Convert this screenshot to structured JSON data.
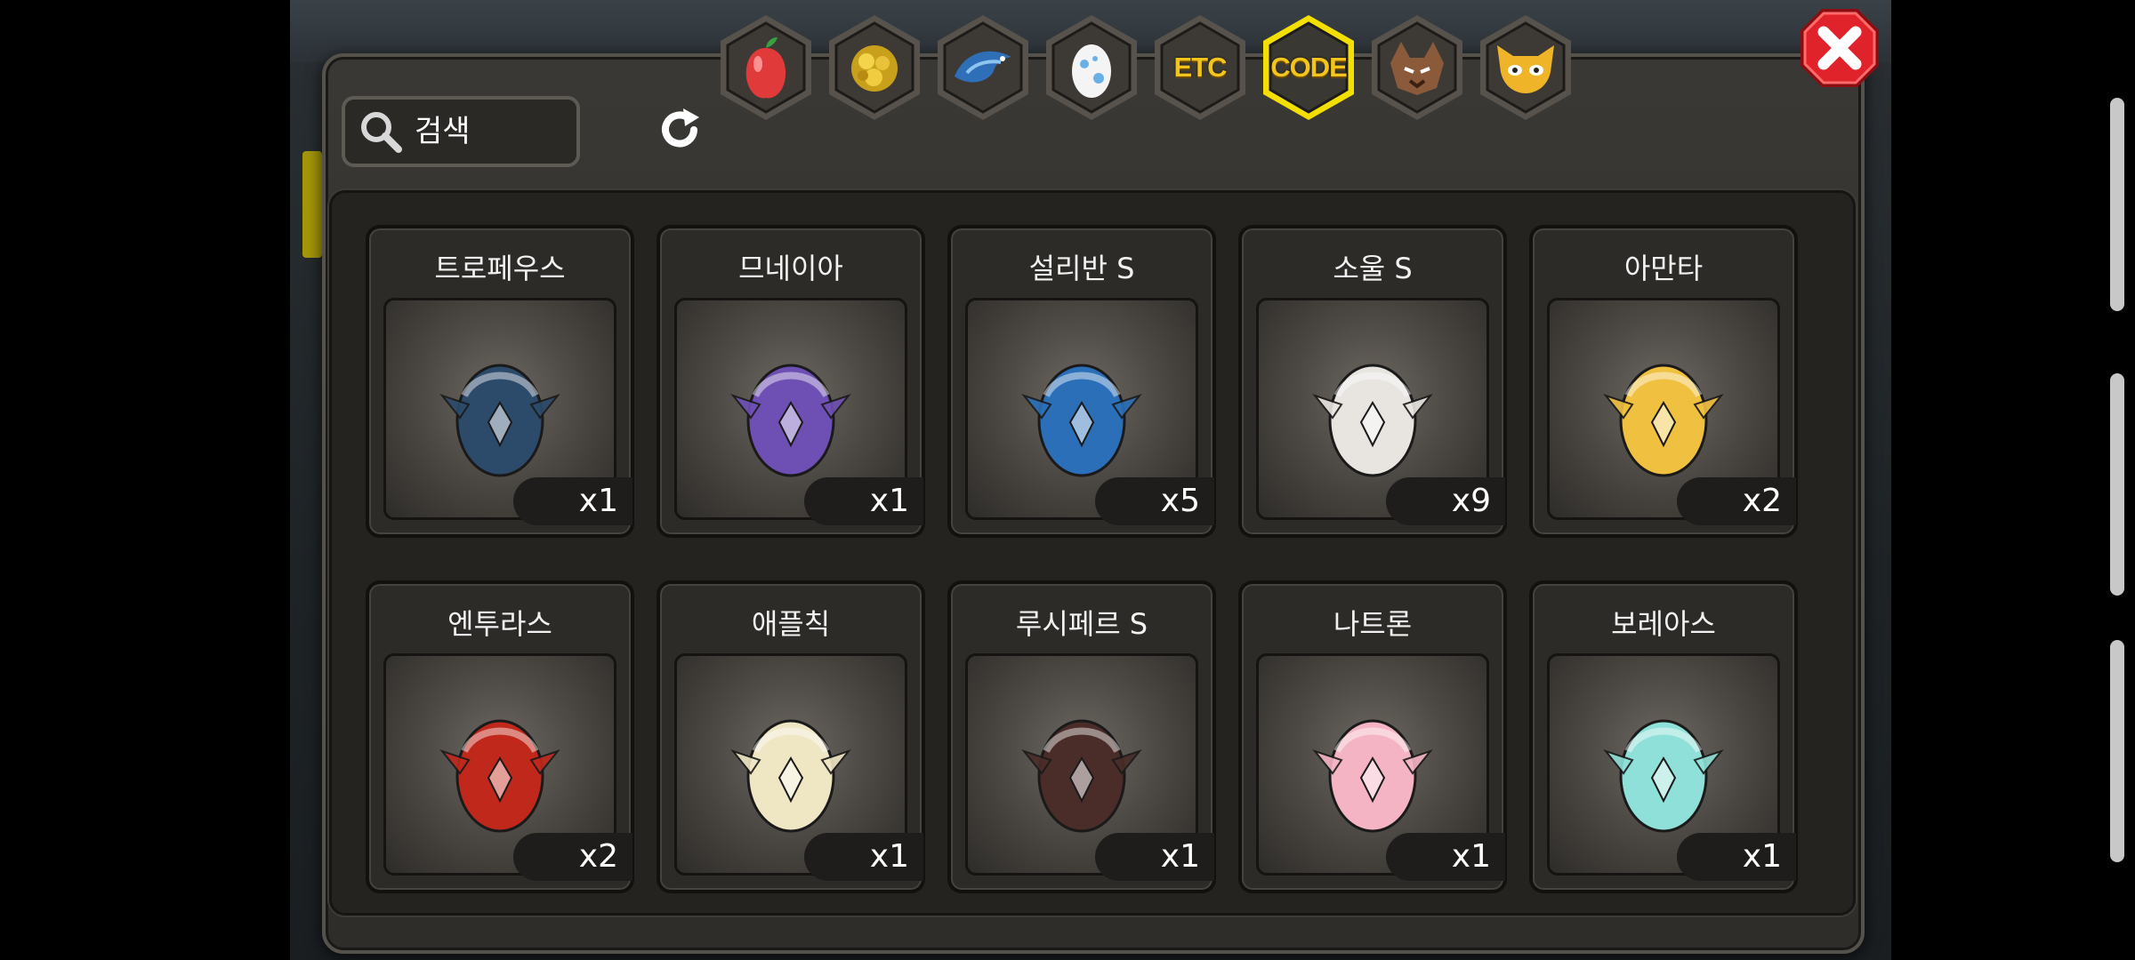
{
  "tabs": [
    {
      "name": "tab-fruit",
      "icon": "fruit-icon",
      "text": "",
      "active": false
    },
    {
      "name": "tab-gold",
      "icon": "gold-ore-icon",
      "text": "",
      "active": false
    },
    {
      "name": "tab-dragon",
      "icon": "dragon-icon",
      "text": "",
      "active": false
    },
    {
      "name": "tab-egg",
      "icon": "egg-icon",
      "text": "",
      "active": false
    },
    {
      "name": "tab-etc",
      "icon": "",
      "text": "ETC",
      "active": false
    },
    {
      "name": "tab-code",
      "icon": "",
      "text": "CODE",
      "active": true
    },
    {
      "name": "tab-beast",
      "icon": "beast-icon",
      "text": "",
      "active": false
    },
    {
      "name": "tab-mask",
      "icon": "mask-icon",
      "text": "",
      "active": false
    }
  ],
  "search": {
    "placeholder": "검색"
  },
  "items": [
    {
      "name": "트로페우스",
      "count": "x1",
      "color": "#2c4a6a"
    },
    {
      "name": "므네이아",
      "count": "x1",
      "color": "#6e4fb4"
    },
    {
      "name": "설리반 S",
      "count": "x5",
      "color": "#2a6fb8"
    },
    {
      "name": "소울 S",
      "count": "x9",
      "color": "#e8e4e0"
    },
    {
      "name": "아만타",
      "count": "x2",
      "color": "#f0c040"
    },
    {
      "name": "엔투라스",
      "count": "x2",
      "color": "#c0281c"
    },
    {
      "name": "애플칙",
      "count": "x1",
      "color": "#efe6c4"
    },
    {
      "name": "루시페르 S",
      "count": "x1",
      "color": "#4a2c28"
    },
    {
      "name": "나트론",
      "count": "x1",
      "color": "#f4b4c4"
    },
    {
      "name": "보레아스",
      "count": "x1",
      "color": "#8fe0d8"
    }
  ],
  "colors": {
    "accent": "#f3e000",
    "close": "#d81a22"
  }
}
